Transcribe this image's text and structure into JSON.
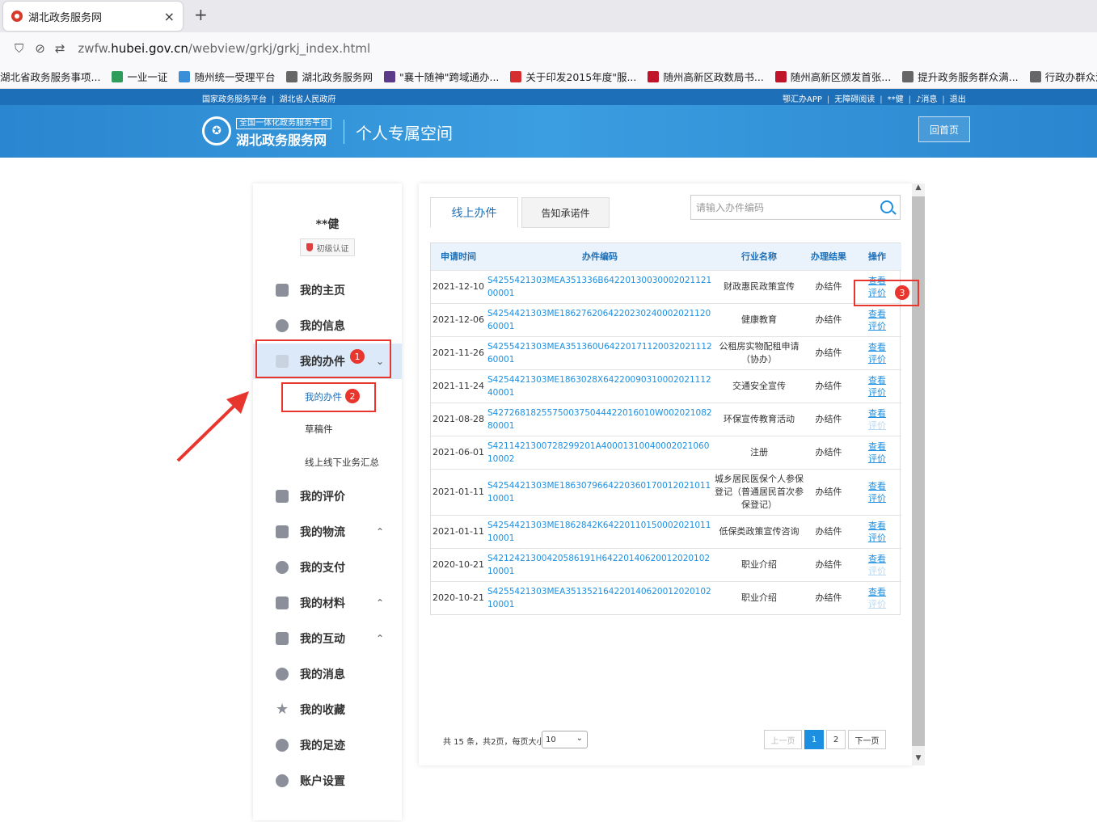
{
  "browser": {
    "tab_title": "湖北政务服务网",
    "tab_close": "×",
    "new_tab": "+",
    "url_prefix": "zwfw.",
    "url_domain": "hubei.gov.cn",
    "url_path": "/webview/grkj/grkj_index.html",
    "bookmarks": [
      {
        "label": "湖北省政务服务事项...",
        "color": "#f9f9fb"
      },
      {
        "label": "一业一证",
        "color": "#2e9d5b"
      },
      {
        "label": "随州统一受理平台",
        "color": "#3a8fd8"
      },
      {
        "label": "湖北政务服务网",
        "color": "#666666"
      },
      {
        "label": "\"襄十随神\"跨域通办...",
        "color": "#5b3a8a"
      },
      {
        "label": "关于印发2015年度\"服...",
        "color": "#d62e2e"
      },
      {
        "label": "随州高新区政数局书...",
        "color": "#c0142b"
      },
      {
        "label": "随州高新区颁发首张...",
        "color": "#c0142b"
      },
      {
        "label": "提升政务服务群众满...",
        "color": "#666666"
      },
      {
        "label": "行政办群众满",
        "color": "#666666"
      }
    ]
  },
  "site": {
    "top_left": [
      "国家政务服务平台",
      "湖北省人民政府"
    ],
    "top_right": [
      "鄂汇办APP",
      "无障碍阅读",
      "**健",
      "消息",
      "退出"
    ],
    "logo_small": "全国一体化政务服务平台",
    "logo_big": "湖北政务服务网",
    "page_title": "个人专属空间",
    "home_button": "回首页"
  },
  "sidebar": {
    "username": "**健",
    "auth_badge": "初级认证",
    "items": [
      {
        "label": "我的主页"
      },
      {
        "label": "我的信息"
      },
      {
        "label": "我的办件",
        "chevron": "⌄"
      },
      {
        "label": "我的评价"
      },
      {
        "label": "我的物流",
        "chevron": "⌃"
      },
      {
        "label": "我的支付"
      },
      {
        "label": "我的材料",
        "chevron": "⌃"
      },
      {
        "label": "我的互动",
        "chevron": "⌃"
      },
      {
        "label": "我的消息"
      },
      {
        "label": "我的收藏"
      },
      {
        "label": "我的足迹"
      },
      {
        "label": "账户设置"
      }
    ],
    "submenu": [
      "我的办件",
      "草稿件",
      "线上线下业务汇总"
    ]
  },
  "main": {
    "tabs": [
      "线上办件",
      "告知承诺件"
    ],
    "search_placeholder": "请输入办件编码",
    "columns": [
      "申请时间",
      "办件编码",
      "行业名称",
      "办理结果",
      "操作"
    ],
    "rows": [
      {
        "date": "2021-12-10",
        "code": "S4255421303MEA351336B6422013003000202112100001",
        "industry": "财政惠民政策宣传",
        "result": "办结件",
        "view": "查看",
        "rate": "评价",
        "rate_dim": false
      },
      {
        "date": "2021-12-06",
        "code": "S4254421303ME18627620642202302400020211206000​1",
        "industry": "健康教育",
        "result": "办结件",
        "view": "查看",
        "rate": "评价",
        "rate_dim": false
      },
      {
        "date": "2021-11-26",
        "code": "S4255421303MEA351360U6422017112003202111260001",
        "industry": "公租房实物配租申请（协办）",
        "result": "办结件",
        "view": "查看",
        "rate": "评价",
        "rate_dim": false
      },
      {
        "date": "2021-11-24",
        "code": "S4254421303ME1863028X642200903100020211124000​1",
        "industry": "交通安全宣传",
        "result": "办结件",
        "view": "查看",
        "rate": "评价",
        "rate_dim": false
      },
      {
        "date": "2021-08-28",
        "code": "S42726818255750037504442201601​0W00202108280001",
        "industry": "环保宣传教育活动",
        "result": "办结件",
        "view": "查看",
        "rate": "评价",
        "rate_dim": true
      },
      {
        "date": "2021-06-01",
        "code": "S421142130072829920​1A400013100400020210601000​2",
        "industry": "注册",
        "result": "办结件",
        "view": "查看",
        "rate": "评价",
        "rate_dim": false
      },
      {
        "date": "2021-01-11",
        "code": "S4254421303ME186307966422036017001202101110001",
        "industry": "城乡居民医保个人参保登记（普通居民首次参保登记）",
        "result": "办结件",
        "view": "查看",
        "rate": "评价",
        "rate_dim": false
      },
      {
        "date": "2021-01-11",
        "code": "S4254421303ME1862842K6422011015000202101110001",
        "industry": "低保类政策宣传咨询",
        "result": "办结件",
        "view": "查看",
        "rate": "评价",
        "rate_dim": false
      },
      {
        "date": "2020-10-21",
        "code": "S4212421300420586191H6422014062001202010210001",
        "industry": "职业介绍",
        "result": "办结件",
        "view": "查看",
        "rate": "评价",
        "rate_dim": true
      },
      {
        "date": "2020-10-21",
        "code": "S4255421303MEA351352164220140620012020102100​01",
        "industry": "职业介绍",
        "result": "办结件",
        "view": "查看",
        "rate": "评价",
        "rate_dim": true
      }
    ],
    "pager": {
      "info": "共 15 条，共2页，每页大小",
      "page_size": "10",
      "prev": "上一页",
      "pages": [
        "1",
        "2"
      ],
      "current": "1",
      "next": "下一页"
    }
  },
  "annotations": [
    "1",
    "2",
    "3"
  ],
  "colors": {
    "brand": "#1d6fb8",
    "link": "#1d8fe0",
    "annotation": "#e8352d"
  }
}
